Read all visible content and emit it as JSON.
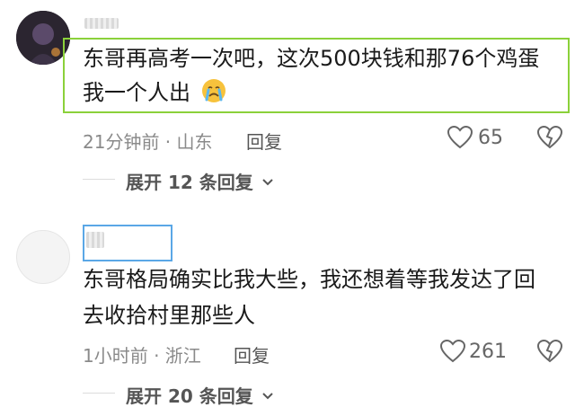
{
  "comments": [
    {
      "text_line1": "东哥再高考一次吧，这次500块钱和那76个鸡蛋",
      "text_line2": "我一个人出",
      "emoji": "crying-face",
      "time_location": "21分钟前 · 山东",
      "reply_label": "回复",
      "likes": "65",
      "expand_label": "展开 12 条回复"
    },
    {
      "text_line1": "东哥格局确实比我大些，我还想着等我发达了回",
      "text_line2": "去收拾村里那些人",
      "time_location": "1小时前 · 浙江",
      "reply_label": "回复",
      "likes": "261",
      "expand_label": "展开 20 条回复"
    }
  ],
  "colors": {
    "highlight_green": "#8bd13a",
    "highlight_blue": "#5aa7e6",
    "meta_gray": "#8a8a8a"
  },
  "icons": [
    "heart-icon",
    "dislike-heart-icon",
    "chevron-down-icon",
    "crying-face-emoji"
  ]
}
